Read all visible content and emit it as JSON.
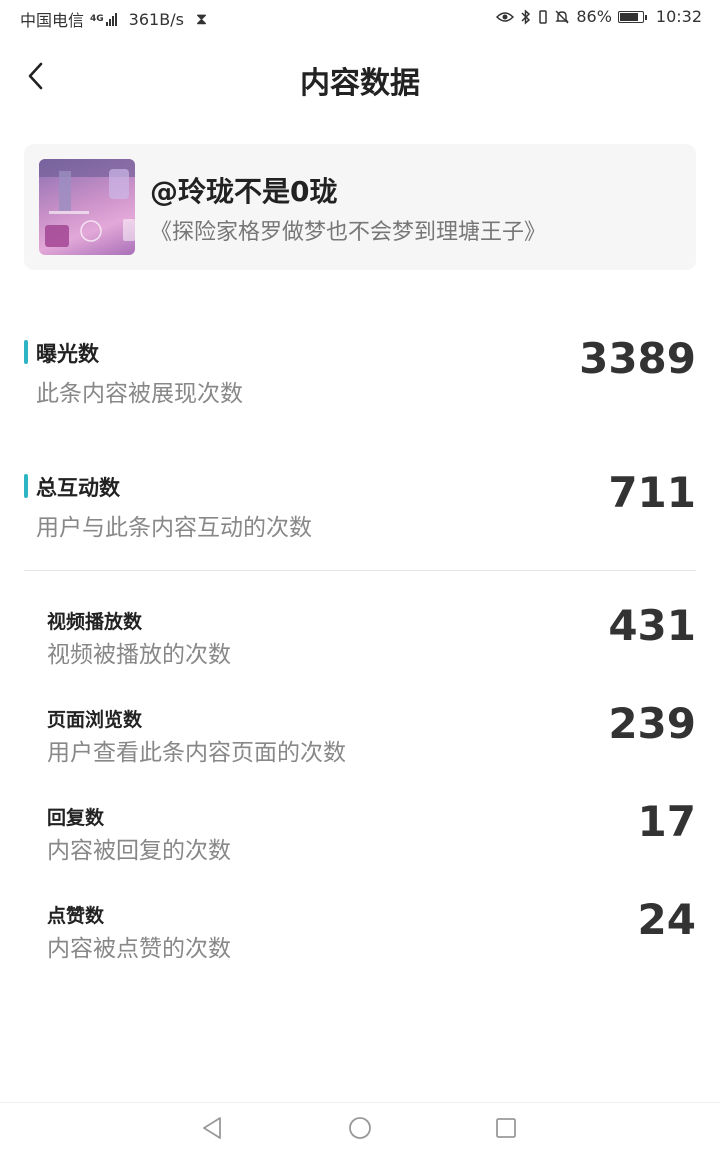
{
  "status_bar": {
    "carrier": "中国电信",
    "network": "4G",
    "speed": "361B/s",
    "battery": "86%",
    "battery_level": 0.86,
    "time": "10:32"
  },
  "header": {
    "title": "内容数据"
  },
  "content": {
    "author": "@玲珑不是0珑",
    "title": "《探险家格罗做梦也不会梦到理塘王子》"
  },
  "metrics": {
    "exposure": {
      "label": "曝光数",
      "desc": "此条内容被展现次数",
      "value": "3389"
    },
    "interaction": {
      "label": "总互动数",
      "desc": "用户与此条内容互动的次数",
      "value": "711"
    },
    "video_plays": {
      "label": "视频播放数",
      "desc": "视频被播放的次数",
      "value": "431"
    },
    "page_views": {
      "label": "页面浏览数",
      "desc": "用户查看此条内容页面的次数",
      "value": "239"
    },
    "replies": {
      "label": "回复数",
      "desc": "内容被回复的次数",
      "value": "17"
    },
    "likes": {
      "label": "点赞数",
      "desc": "内容被点赞的次数",
      "value": "24"
    }
  },
  "colors": {
    "accent": "#2db5c4"
  }
}
